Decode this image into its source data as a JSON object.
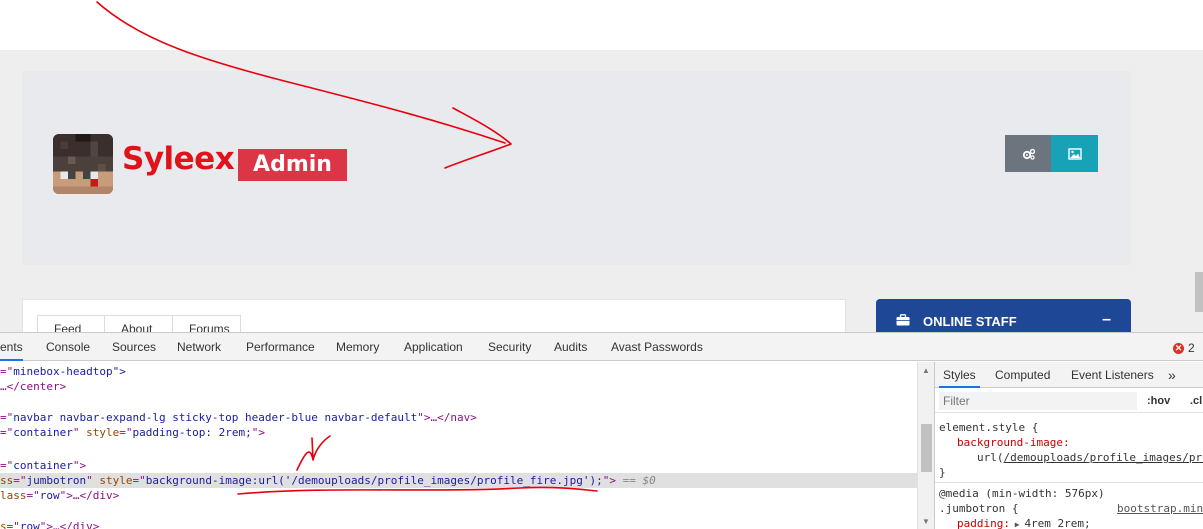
{
  "profile": {
    "name": "Syleex",
    "badge": "Admin"
  },
  "content_tabs": [
    "Feed",
    "About",
    "Forums"
  ],
  "online_staff": {
    "title": "ONLINE STAFF",
    "collapse": "–"
  },
  "devtools": {
    "tabs": [
      "ents",
      "Console",
      "Sources",
      "Network",
      "Performance",
      "Memory",
      "Application",
      "Security",
      "Audits",
      "Avast Passwords"
    ],
    "error_count": "2",
    "dom": {
      "l1_val": "minebox-headtop\">",
      "l2": "…</center>",
      "l3_val": "navbar navbar-expand-lg sticky-top header-blue navbar-default",
      "l3_end": "…</nav>",
      "l4_val": "container",
      "l4_attr": "style",
      "l4_style": "padding-top: 2rem;",
      "l5_val": "container",
      "l6_attr_a": "ss",
      "l6_val_a": "jumbotron",
      "l6_attr_b": "style",
      "l6_val_b": "background-image:url('/demouploads/profile_images/profile_fire.jpg');",
      "l6_eq": "== $0",
      "l7_attr": "lass",
      "l7_val": "row",
      "l7_end": "…</div>",
      "l8_attr": "s",
      "l8_val": "row",
      "l8_end": "…</div>"
    },
    "styles": {
      "tabs": [
        "Styles",
        "Computed",
        "Event Listeners",
        "»"
      ],
      "filter_placeholder": "Filter",
      "hov": ":hov",
      "cls": ".cl",
      "element_style": "element.style {",
      "bg_prop": "background-image:",
      "bg_val": "/demouploads/profile_images/pro",
      "close": "}",
      "media": "@media (min-width: 576px)",
      "jumbo_selector": ".jumbotron {",
      "jumbo_source": "bootstrap.min",
      "padding_prop": "padding:",
      "padding_val": "4rem 2rem;"
    }
  },
  "colors": {
    "name_red": "#e0121a",
    "badge_red": "#dc3545",
    "btn_gray": "#6c757d",
    "btn_teal": "#17a2b8",
    "staff_blue": "#1e4796",
    "annotation_red": "#e8000d"
  },
  "icons": {
    "gray_button": "cogs-icon",
    "teal_button": "image-icon",
    "staff": "briefcase-icon",
    "error": "error-icon",
    "more": "chevron-double-right-icon"
  }
}
